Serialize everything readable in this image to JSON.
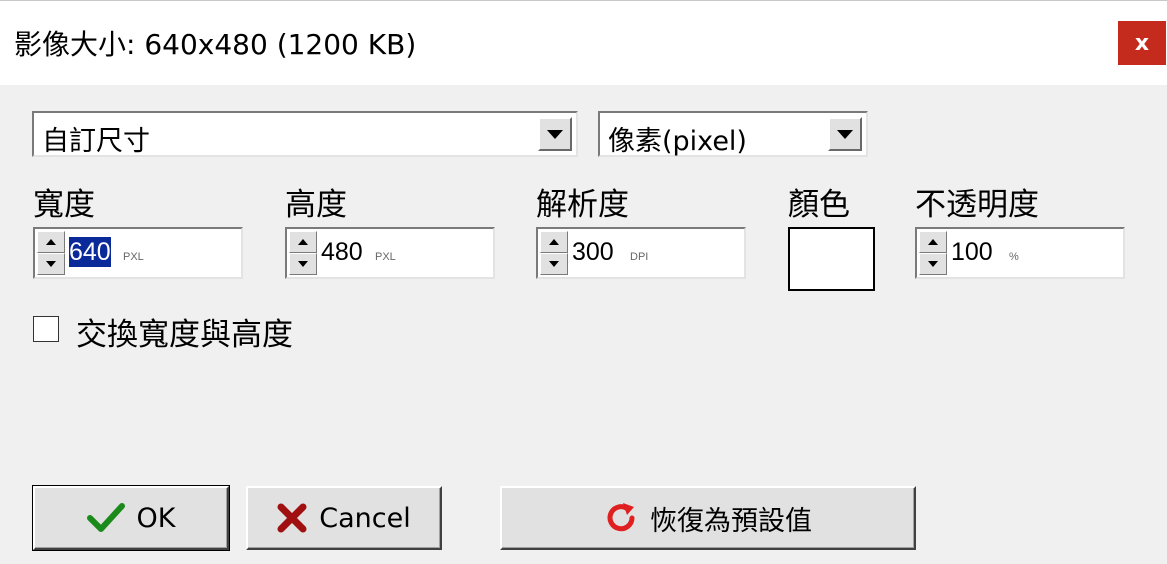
{
  "dialog": {
    "title": "影像大小: 640x480 (1200 KB)",
    "close_label": "x"
  },
  "size_preset": {
    "value": "自訂尺寸"
  },
  "unit_select": {
    "value": "像素(pixel)"
  },
  "fields": {
    "width": {
      "label": "寬度",
      "value": "640",
      "unit": "PXL"
    },
    "height": {
      "label": "高度",
      "value": "480",
      "unit": "PXL"
    },
    "resolution": {
      "label": "解析度",
      "value": "300",
      "unit": "DPI"
    },
    "color": {
      "label": "顏色",
      "swatch": "#ffffff"
    },
    "opacity": {
      "label": "不透明度",
      "value": "100",
      "unit": "%"
    }
  },
  "swap_checkbox": {
    "label": "交換寬度與高度",
    "checked": false
  },
  "buttons": {
    "ok": "OK",
    "cancel": "Cancel",
    "reset": "恢復為預設值"
  },
  "icons": {
    "ok": "checkmark-icon",
    "cancel": "x-mark-icon",
    "reset": "refresh-icon"
  },
  "colors": {
    "close_bg": "#c42b1c",
    "check_green": "#1a8a1a",
    "cancel_red": "#a01010",
    "reset_red": "#e02020",
    "selection": "#0a2a9a"
  }
}
